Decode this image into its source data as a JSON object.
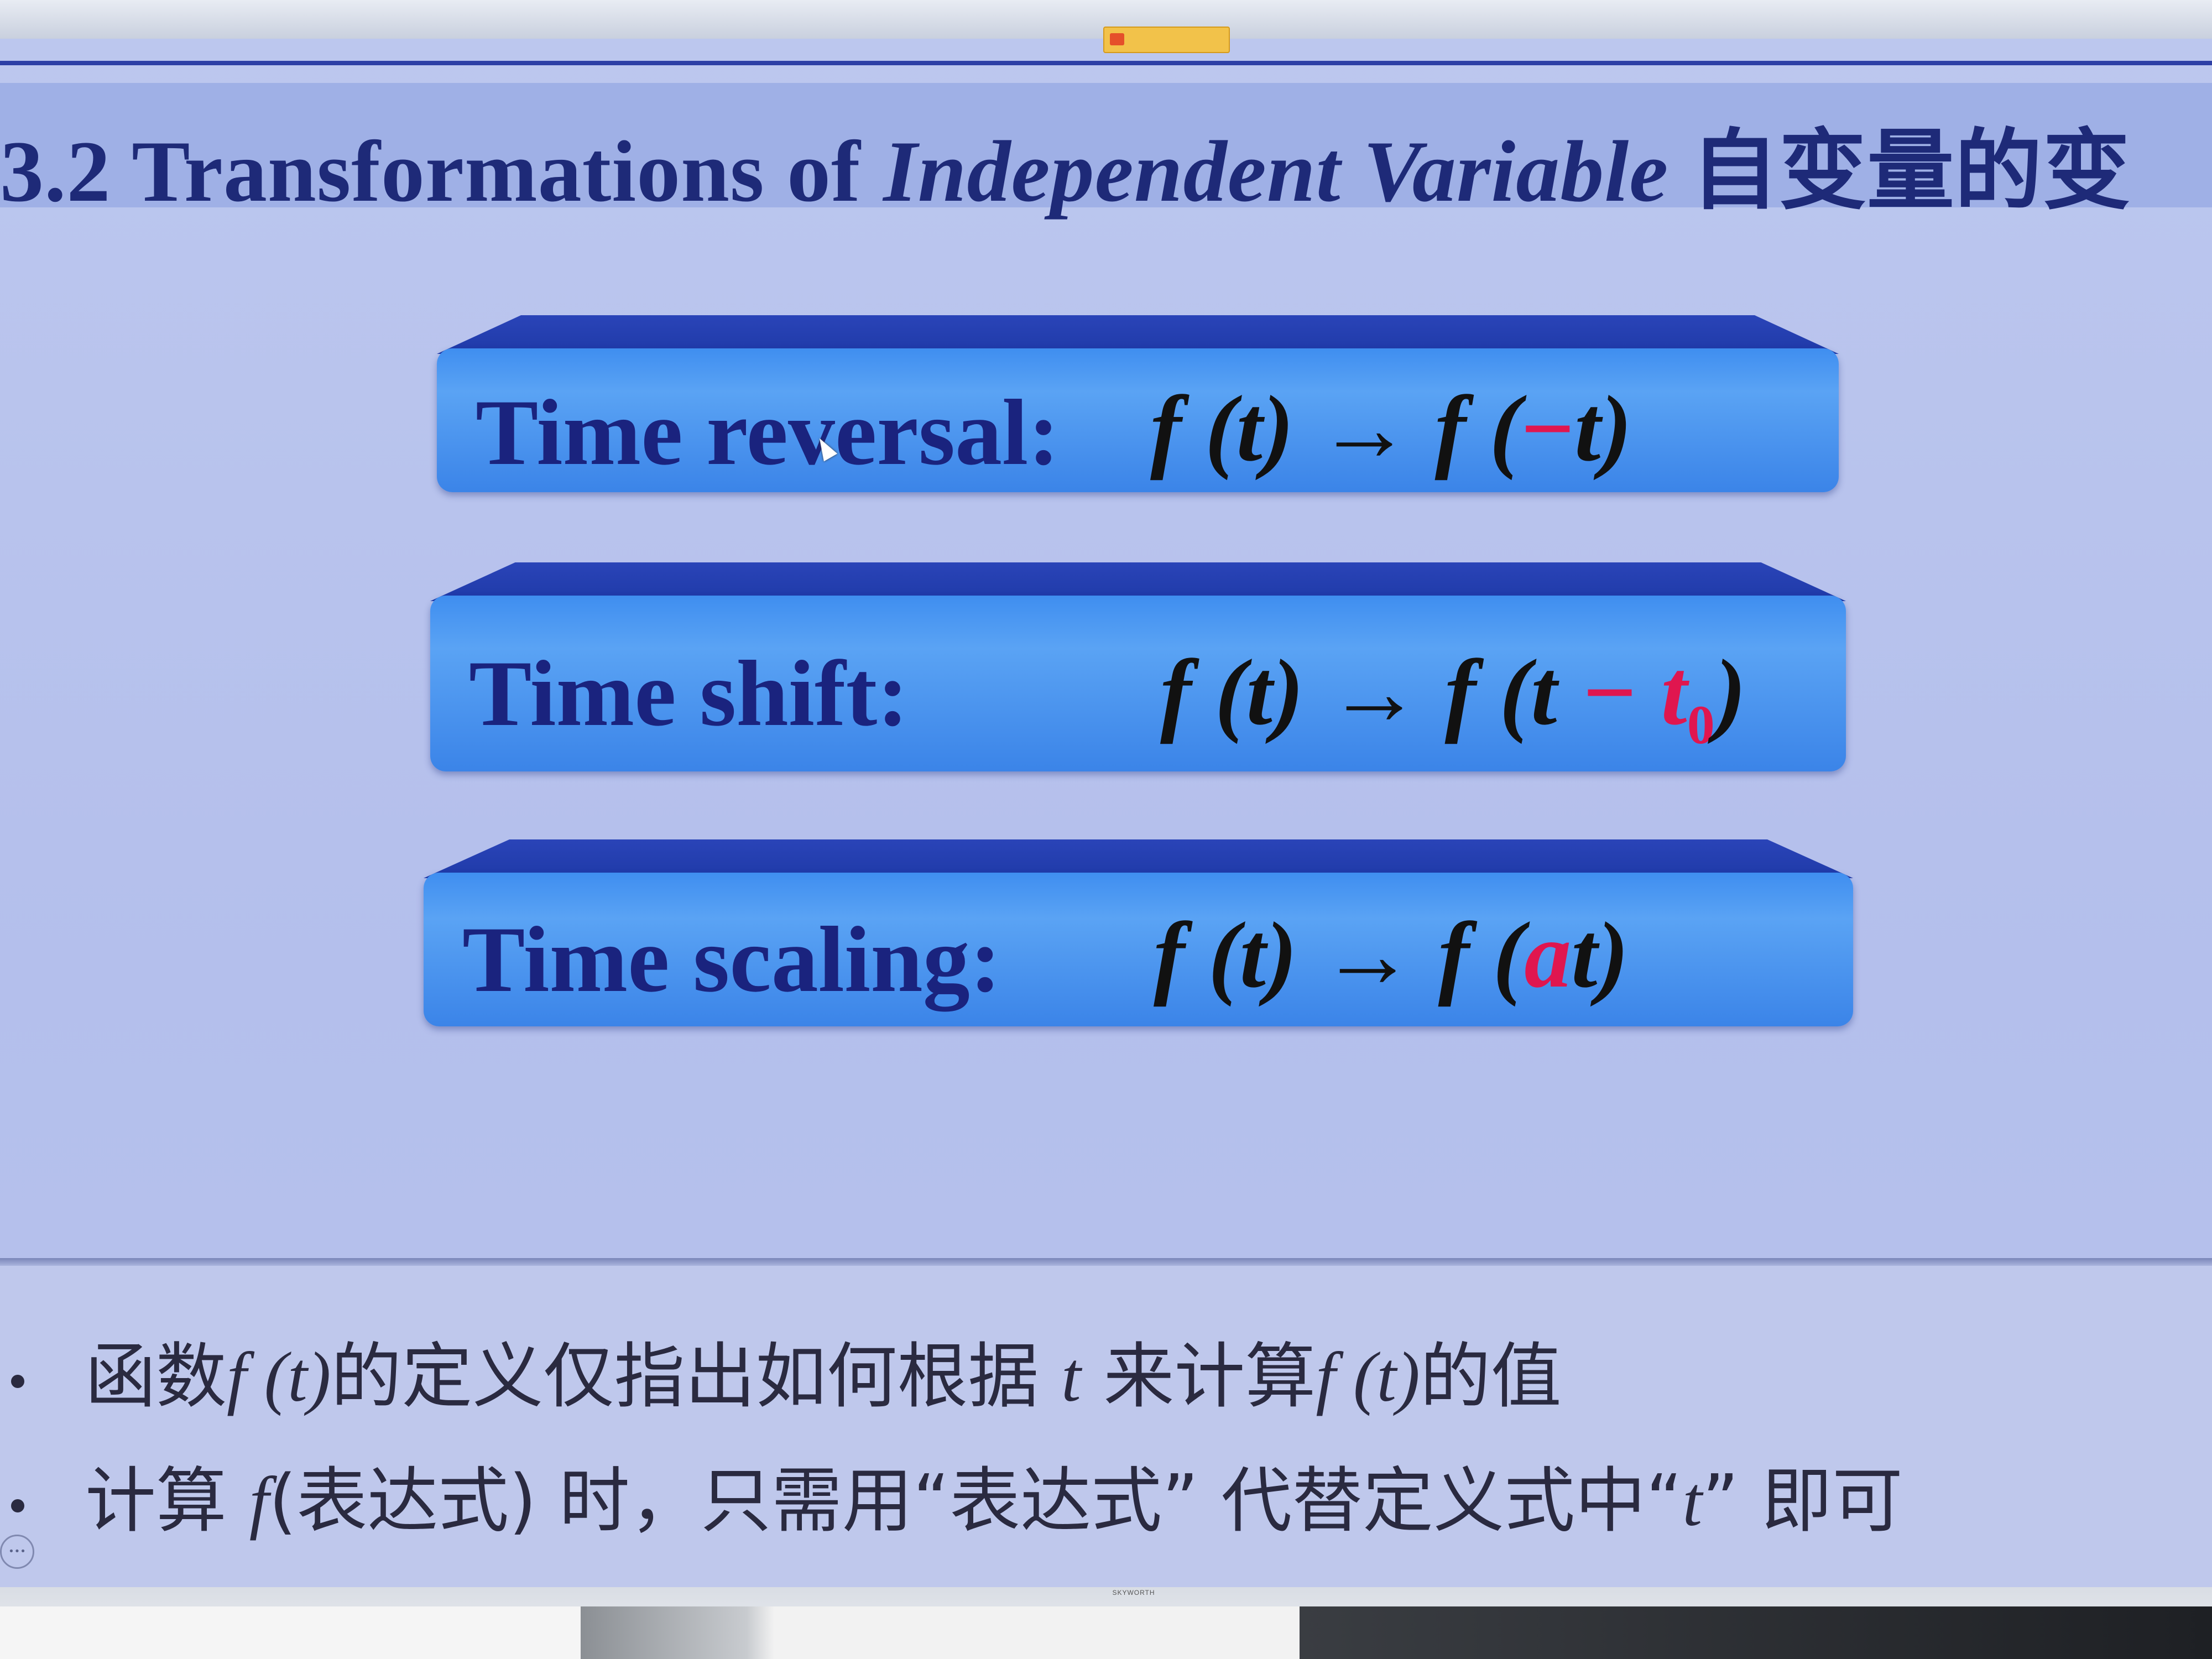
{
  "title": {
    "number": "3.2",
    "word1": "Transformations of",
    "italic": "Independent Variable",
    "chinese": "自变量的变"
  },
  "transformations": [
    {
      "label": "Time reversal:",
      "lhs": "f (t)",
      "arrow": "→",
      "rhs_open": "f (",
      "rhs_red": "−",
      "rhs_tail": "t)"
    },
    {
      "label": "Time shift:",
      "lhs": "f (t)",
      "arrow": "→",
      "rhs_open": "f (t ",
      "rhs_red": "− t",
      "rhs_sub": "0",
      "rhs_tail": ")"
    },
    {
      "label": "Time scaling:",
      "lhs": "f (t)",
      "arrow": "→",
      "rhs_open": "f (",
      "rhs_red": "a",
      "rhs_tail": "t)"
    }
  ],
  "bullets": [
    {
      "p1": "函数",
      "m1": "f (t)",
      "p2": "的定义仅指出如何根据 ",
      "m2": "t",
      "p3": " 来计算",
      "m3": "f (t)",
      "p4": "的值"
    },
    {
      "p1": "计算 ",
      "m1": "f",
      "p2": "(表达式) 时，只需用“表达式” 代替定义式中“",
      "m2": "t",
      "p3": "” 即可"
    }
  ],
  "bezel": {
    "brand": "SKYWORTH"
  },
  "icons": {
    "toolbar": "slideshow-toolbar-icon",
    "cursor": "mouse-cursor-icon",
    "corner": "more-options-icon"
  },
  "colors": {
    "title_text": "#1e2a78",
    "box_face": "#3f8ef0",
    "box_lid": "#1f3aa8",
    "highlight_red": "#e0164f"
  }
}
